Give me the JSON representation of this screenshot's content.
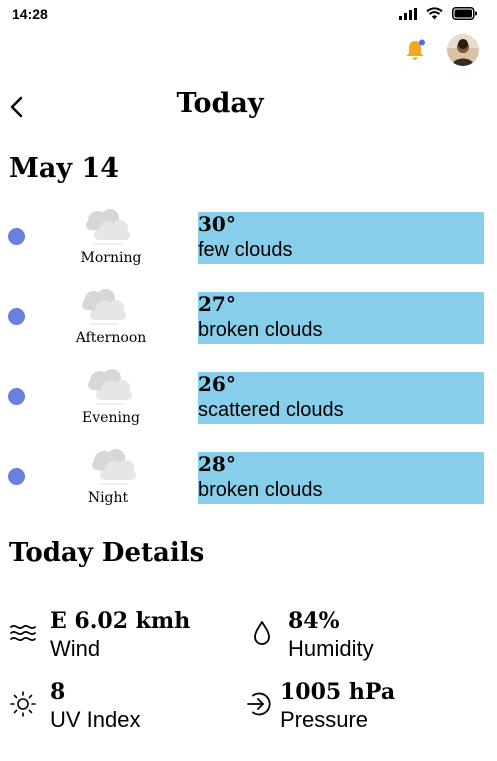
{
  "status_bar": {
    "time": "14:28"
  },
  "header": {
    "title": "Today"
  },
  "date": "May 14",
  "forecast": [
    {
      "period": "Morning",
      "temp": "30°",
      "desc": "few clouds"
    },
    {
      "period": "Afternoon",
      "temp": "27°",
      "desc": "broken clouds"
    },
    {
      "period": "Evening",
      "temp": "26°",
      "desc": "scattered clouds"
    },
    {
      "period": "Night",
      "temp": "28°",
      "desc": "broken clouds"
    }
  ],
  "details": {
    "title": "Today Details",
    "wind": {
      "value": "E 6.02 kmh",
      "label": "Wind"
    },
    "humidity": {
      "value": "84%",
      "label": "Humidity"
    },
    "uv": {
      "value": "8",
      "label": "UV Index"
    },
    "pressure": {
      "value": "1005 hPa",
      "label": "Pressure"
    }
  },
  "colors": {
    "card": "#87ceeb",
    "dot": "#6b7fe0",
    "bell": "#f5a623",
    "notification_dot": "#4a6cf7"
  },
  "icons": [
    "signal-icon",
    "wifi-icon",
    "battery-icon",
    "bell-icon",
    "back-chevron-icon",
    "cloud-icon",
    "wind-icon",
    "humidity-drop-icon",
    "sun-icon",
    "pressure-icon"
  ]
}
